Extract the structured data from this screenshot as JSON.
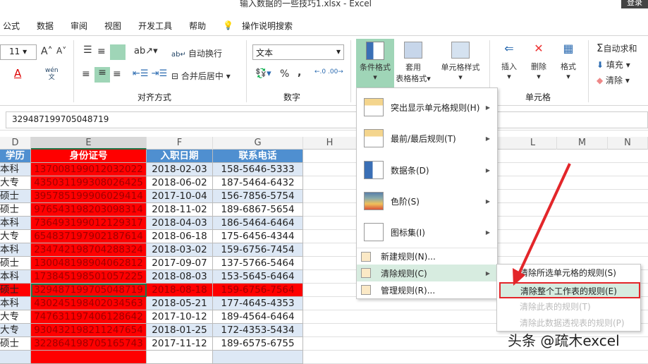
{
  "window": {
    "title": "输入数据的一些技巧1.xlsx  -  Excel",
    "login": "登录"
  },
  "tabs": [
    "公式",
    "数据",
    "审阅",
    "视图",
    "开发工具",
    "帮助",
    "操作说明搜索"
  ],
  "ribbon": {
    "font_size": "11",
    "phonetic": "wén\n文",
    "wrap_text": "自动换行",
    "merge_center": "合并后居中",
    "align_group": "对齐方式",
    "number_format": "文本",
    "number_group": "数字",
    "percent": "%",
    "comma": ",",
    "cond_format": "条件格式",
    "table_format_1": "套用",
    "table_format_2": "表格格式",
    "cell_style": "单元格样式",
    "insert": "插入",
    "delete": "删除",
    "format": "格式",
    "cells_group": "单元格",
    "autosum": "自动求和",
    "fill": "填充",
    "clear": "清除"
  },
  "formula_bar": {
    "value": "329487199705048719"
  },
  "columns": [
    "D",
    "E",
    "F",
    "G",
    "H",
    "L",
    "M",
    "N"
  ],
  "table": {
    "headers": [
      "学历",
      "身份证号",
      "入职日期",
      "联系电话"
    ],
    "rows": [
      [
        "本科",
        "137008199012032022",
        "2018-02-03",
        "158-5646-5333"
      ],
      [
        "大专",
        "435031199308026425",
        "2018-06-02",
        "187-5464-6432"
      ],
      [
        "硕士",
        "395785199906029414",
        "2017-10-04",
        "156-7856-5754"
      ],
      [
        "硕士",
        "976543198203098314",
        "2018-11-02",
        "189-6867-5654"
      ],
      [
        "本科",
        "736493199012129317",
        "2018-04-03",
        "186-5464-6464"
      ],
      [
        "大专",
        "654837197902187614",
        "2018-06-18",
        "175-6456-4344"
      ],
      [
        "本科",
        "234742198704288324",
        "2018-03-02",
        "159-6756-7454"
      ],
      [
        "硕士",
        "130048198904062812",
        "2017-09-07",
        "137-5766-5464"
      ],
      [
        "本科",
        "173845198501057225",
        "2018-08-03",
        "153-5645-6464"
      ],
      [
        "硕士",
        "329487199705048719",
        "2018-08-18",
        "159-6756-7564"
      ],
      [
        "本科",
        "430245198402034563",
        "2018-05-21",
        "177-4645-4353"
      ],
      [
        "大专",
        "747631197406128642",
        "2017-10-12",
        "189-4564-6464"
      ],
      [
        "大专",
        "930432198211247654",
        "2018-01-25",
        "172-4353-5434"
      ],
      [
        "硕士",
        "322864198705165743",
        "2017-11-12",
        "189-6575-6755"
      ]
    ]
  },
  "menu": {
    "items": [
      "突出显示单元格规则(H)",
      "最前/最后规则(T)",
      "数据条(D)",
      "色阶(S)",
      "图标集(I)",
      "新建规则(N)...",
      "清除规则(C)",
      "管理规则(R)..."
    ]
  },
  "submenu": {
    "items": [
      "清除所选单元格的规则(S)",
      "清除整个工作表的规则(E)",
      "清除此表的规则(T)",
      "清除此数据透视表的规则(P)"
    ]
  },
  "watermark": "头条 @疏木excel",
  "colors": {
    "red": "#ff0000",
    "header_blue": "#4f8fd0",
    "band": "#dde8f5",
    "accent": "#9fd5b7",
    "annot": "#e3262a"
  }
}
